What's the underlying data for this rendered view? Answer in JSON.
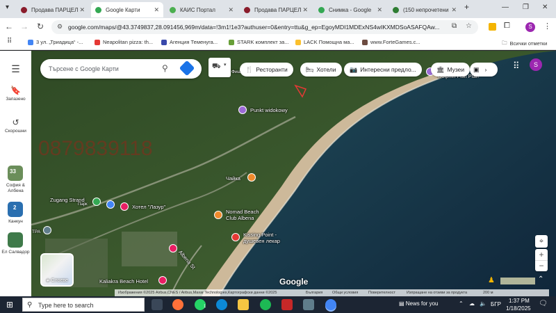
{
  "tabs": [
    {
      "label": "Продава ПАРЦЕЛ",
      "color": "#8a1c2b"
    },
    {
      "label": "Google Карти",
      "color": "#34a853"
    },
    {
      "label": "КАИС Портал",
      "color": "#4caf50"
    },
    {
      "label": "Продава ПАРЦЕЛ",
      "color": "#8a1c2b"
    },
    {
      "label": "Снимка - Google",
      "color": "#34a853"
    },
    {
      "label": "(150 непрочетени",
      "color": "#2e7d32"
    }
  ],
  "toolbar": {
    "url": "google.com/maps/@43.3749837,28.091456,969m/data=!3m1!1e3?authuser=0&entry=ttu&g_ep=EgoyMDI1MDExNS4wIKXMDSoASAFQAw...",
    "profile_initial": "S"
  },
  "bookmarks": [
    {
      "label": "3 ул. „Триадица“ -...",
      "color": "#4285f4"
    },
    {
      "label": "Neapolitan pizza: th...",
      "color": "#e53935"
    },
    {
      "label": "Агенция Теменуга...",
      "color": "#3949ab"
    },
    {
      "label": "STARK комплект за...",
      "color": "#689f38"
    },
    {
      "label": "LACK Помощна ма...",
      "color": "#fbc02d"
    },
    {
      "label": "www.ForteGames.c...",
      "color": "#6d4c41"
    }
  ],
  "bookmarks_all": "Всички отметки",
  "rail": {
    "menu": "Меню",
    "saved": "Запазено",
    "recent": "Скорошни",
    "places": [
      {
        "label": "София & Албена",
        "badge": "33",
        "color": "#6b8e5a"
      },
      {
        "label": "Канкун",
        "badge": "2",
        "color": "#2a6fb0"
      },
      {
        "label": "Ел Салвадор",
        "badge": "",
        "color": "#3f7a4a"
      }
    ]
  },
  "search": {
    "placeholder": "Търсене с Google Карти"
  },
  "chips": [
    {
      "icon": "🍴",
      "label": "Ресторанти"
    },
    {
      "icon": "🛏",
      "label": "Хотели"
    },
    {
      "icon": "📷",
      "label": "Интересни предло..."
    },
    {
      "icon": "🏛",
      "label": "Музеи"
    }
  ],
  "map": {
    "watermark": "0879839118",
    "pois": {
      "widokowy": "Punkt widokowy",
      "chaika": "Чайка",
      "zugang": "Zugang Strand",
      "park": "Парк",
      "hotel_lazur": "Хотел \"Лазур\"",
      "nomad": "Nomad Beach\nClub Albena",
      "kissing": "Kissing Point -\nдушевен лекар",
      "albena": "Albena St",
      "kaliakra": "Kaliakra Beach Hotel",
      "dolphin": "Dolphin Fish Plan",
      "tra": "TPA",
      "sklep": "Фиш"
    },
    "layers_label": "Слоеве",
    "google_logo": "Google",
    "footer": {
      "imagery": "Изображения ©2025 Airbus,CNES / Airbus,Maxar Technologies,Картографски данни ©2025",
      "country": "България",
      "terms": "Общи условия",
      "privacy": "Поверителност",
      "feedback": "Изпращане на отзиви за продукта",
      "scale": "200 м"
    }
  },
  "taskbar": {
    "search_placeholder": "Type here to search",
    "news": "News for you",
    "lang": "БГР",
    "time": "1:37 PM",
    "date": "1/18/2025",
    "whatsapp_badge": "1"
  }
}
